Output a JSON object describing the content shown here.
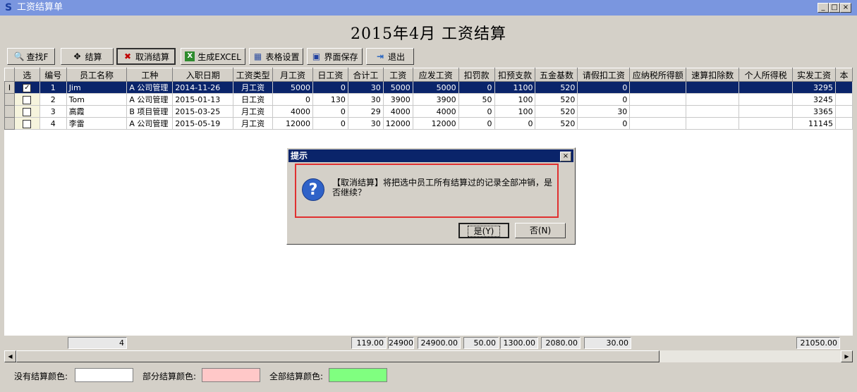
{
  "window": {
    "title": "工资结算单",
    "app_icon": "S"
  },
  "header_title": "2015年4月  工资结算",
  "toolbar": [
    {
      "label": "查找F",
      "icon": "binoculars-icon",
      "glyph": "🔍"
    },
    {
      "label": "结算",
      "icon": "settle-icon",
      "glyph": "✥"
    },
    {
      "label": "取消结算",
      "icon": "cancel-x-icon",
      "glyph": "✖"
    },
    {
      "label": "生成EXCEL",
      "icon": "excel-icon",
      "glyph": "X"
    },
    {
      "label": "表格设置",
      "icon": "table-icon",
      "glyph": "▦"
    },
    {
      "label": "界面保存",
      "icon": "save-icon",
      "glyph": "▣"
    },
    {
      "label": "退出",
      "icon": "exit-icon",
      "glyph": "⇥"
    }
  ],
  "columns": [
    "选",
    "编号",
    "员工名称",
    "工种",
    "入职日期",
    "工资类型",
    "月工资",
    "日工资",
    "合计工",
    "工资",
    "应发工资",
    "扣罚款",
    "扣预支款",
    "五金基数",
    "请假扣工资",
    "应纳税所得额",
    "速算扣除数",
    "个人所得税",
    "实发工资",
    "本"
  ],
  "rows": [
    {
      "indicator": "I",
      "checked": true,
      "cells": [
        "1",
        "Jim",
        "A 公司管理",
        "2014-11-26",
        "月工资",
        "5000",
        "0",
        "30",
        "5000",
        "5000",
        "0",
        "1100",
        "520",
        "0",
        "",
        "",
        "",
        "3295",
        ""
      ]
    },
    {
      "indicator": "",
      "checked": false,
      "cells": [
        "2",
        "Tom",
        "A 公司管理",
        "2015-01-13",
        "日工资",
        "0",
        "130",
        "30",
        "3900",
        "3900",
        "50",
        "100",
        "520",
        "0",
        "",
        "",
        "",
        "3245",
        ""
      ]
    },
    {
      "indicator": "",
      "checked": false,
      "cells": [
        "3",
        "高霞",
        "B 项目管理",
        "2015-03-25",
        "月工资",
        "4000",
        "0",
        "29",
        "4000",
        "4000",
        "0",
        "100",
        "520",
        "30",
        "",
        "",
        "",
        "3365",
        ""
      ]
    },
    {
      "indicator": "",
      "checked": false,
      "cells": [
        "4",
        "李雷",
        "A 公司管理",
        "2015-05-19",
        "月工资",
        "12000",
        "0",
        "30",
        "12000",
        "12000",
        "0",
        "0",
        "520",
        "0",
        "",
        "",
        "",
        "11145",
        ""
      ]
    }
  ],
  "sums": [
    "4",
    "119.00",
    "24900",
    "24900.00",
    "50.00",
    "1300.00",
    "2080.00",
    "30.00",
    "21050.00"
  ],
  "legend": {
    "none_label": "没有结算颜色:",
    "partial_label": "部分结算颜色:",
    "all_label": "全部结算颜色:",
    "none_color": "#ffffff",
    "partial_color": "#ffc8c8",
    "all_color": "#80ff80"
  },
  "dialog": {
    "title": "提示",
    "message": "【取消结算】将把选中员工所有结算过的记录全部冲销，是否继续？",
    "yes": "是(Y)",
    "no": "否(N)"
  }
}
